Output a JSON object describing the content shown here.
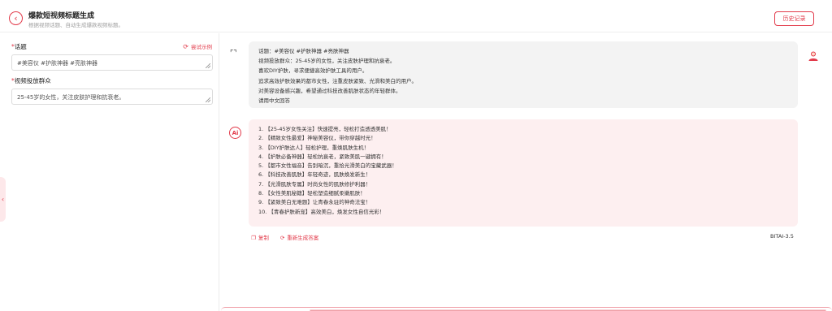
{
  "header": {
    "title": "爆款短视频标题生成",
    "subtitle": "根据视频话题、自动生成爆款视频标题。",
    "history_label": "历史记录"
  },
  "form": {
    "topic_label": "话题",
    "try_example_label": "尝试示例",
    "topic_value": "#美容仪 #护肤神器 #亮肤神器",
    "audience_label": "视频投放群众",
    "audience_value": "25-45岁的女性，关注皮肤护理和抗衰老。"
  },
  "user_message": {
    "lines": [
      "话题：#美容仪 #护肤神器 #亮肤神器",
      "视频投放群众：25-45岁的女性，关注皮肤护理和抗衰老。",
      "喜欢DIY护肤，寻求便捷高效护肤工具的用户。",
      "追求高效护肤效果的都市女性，注重皮肤紧致、光滑和美白的用户。",
      "对美容设备感兴趣，希望通过科技改善肌肤状态的年轻群体。",
      "请用中文回答"
    ]
  },
  "ai_message": {
    "lines": [
      "1. 【25-45岁女性关注】快速提亮，轻松打造透透美肌！",
      "2. 【精致女性最爱】神秘美容仪，带你穿越时光！",
      "3. 【DIY护肤达人】轻松护理，重焕肌肤生机！",
      "4. 【护肤必备神器】轻松抗衰老，紧致美肌一键拥有！",
      "5. 【都市女性福音】告别暗沉，重拾光滑美白的宝藏武器！",
      "6. 【科技改善肌肤】年轻奇迹，肌肤焕发新生！",
      "7. 【光滑肌肤专属】时尚女性的肌肤修护利器！",
      "8. 【女性美肌秘籍】轻松塑造细腻柔嫩肌肤！",
      "9. 【紧致美白无难题】让青春永驻的神奇法宝！",
      "10. 【青春护肤新宠】高效美白，焕发女性自信光彩！"
    ],
    "ai_icon_text": "Ai"
  },
  "actions": {
    "copy_label": "复制",
    "regenerate_label": "重新生成答案",
    "model": "BITAI-3.5"
  },
  "icons": {
    "back": "chevron-left-icon",
    "try_example": "sync-icon",
    "expand": "expand-icon",
    "avatar": "user-avatar-icon",
    "copy": "copy-icon",
    "regenerate": "refresh-icon"
  },
  "colors": {
    "accent": "#e23a4a",
    "ai_bubble_bg": "#fdeff0",
    "user_bubble_bg": "#f3f3f3"
  }
}
